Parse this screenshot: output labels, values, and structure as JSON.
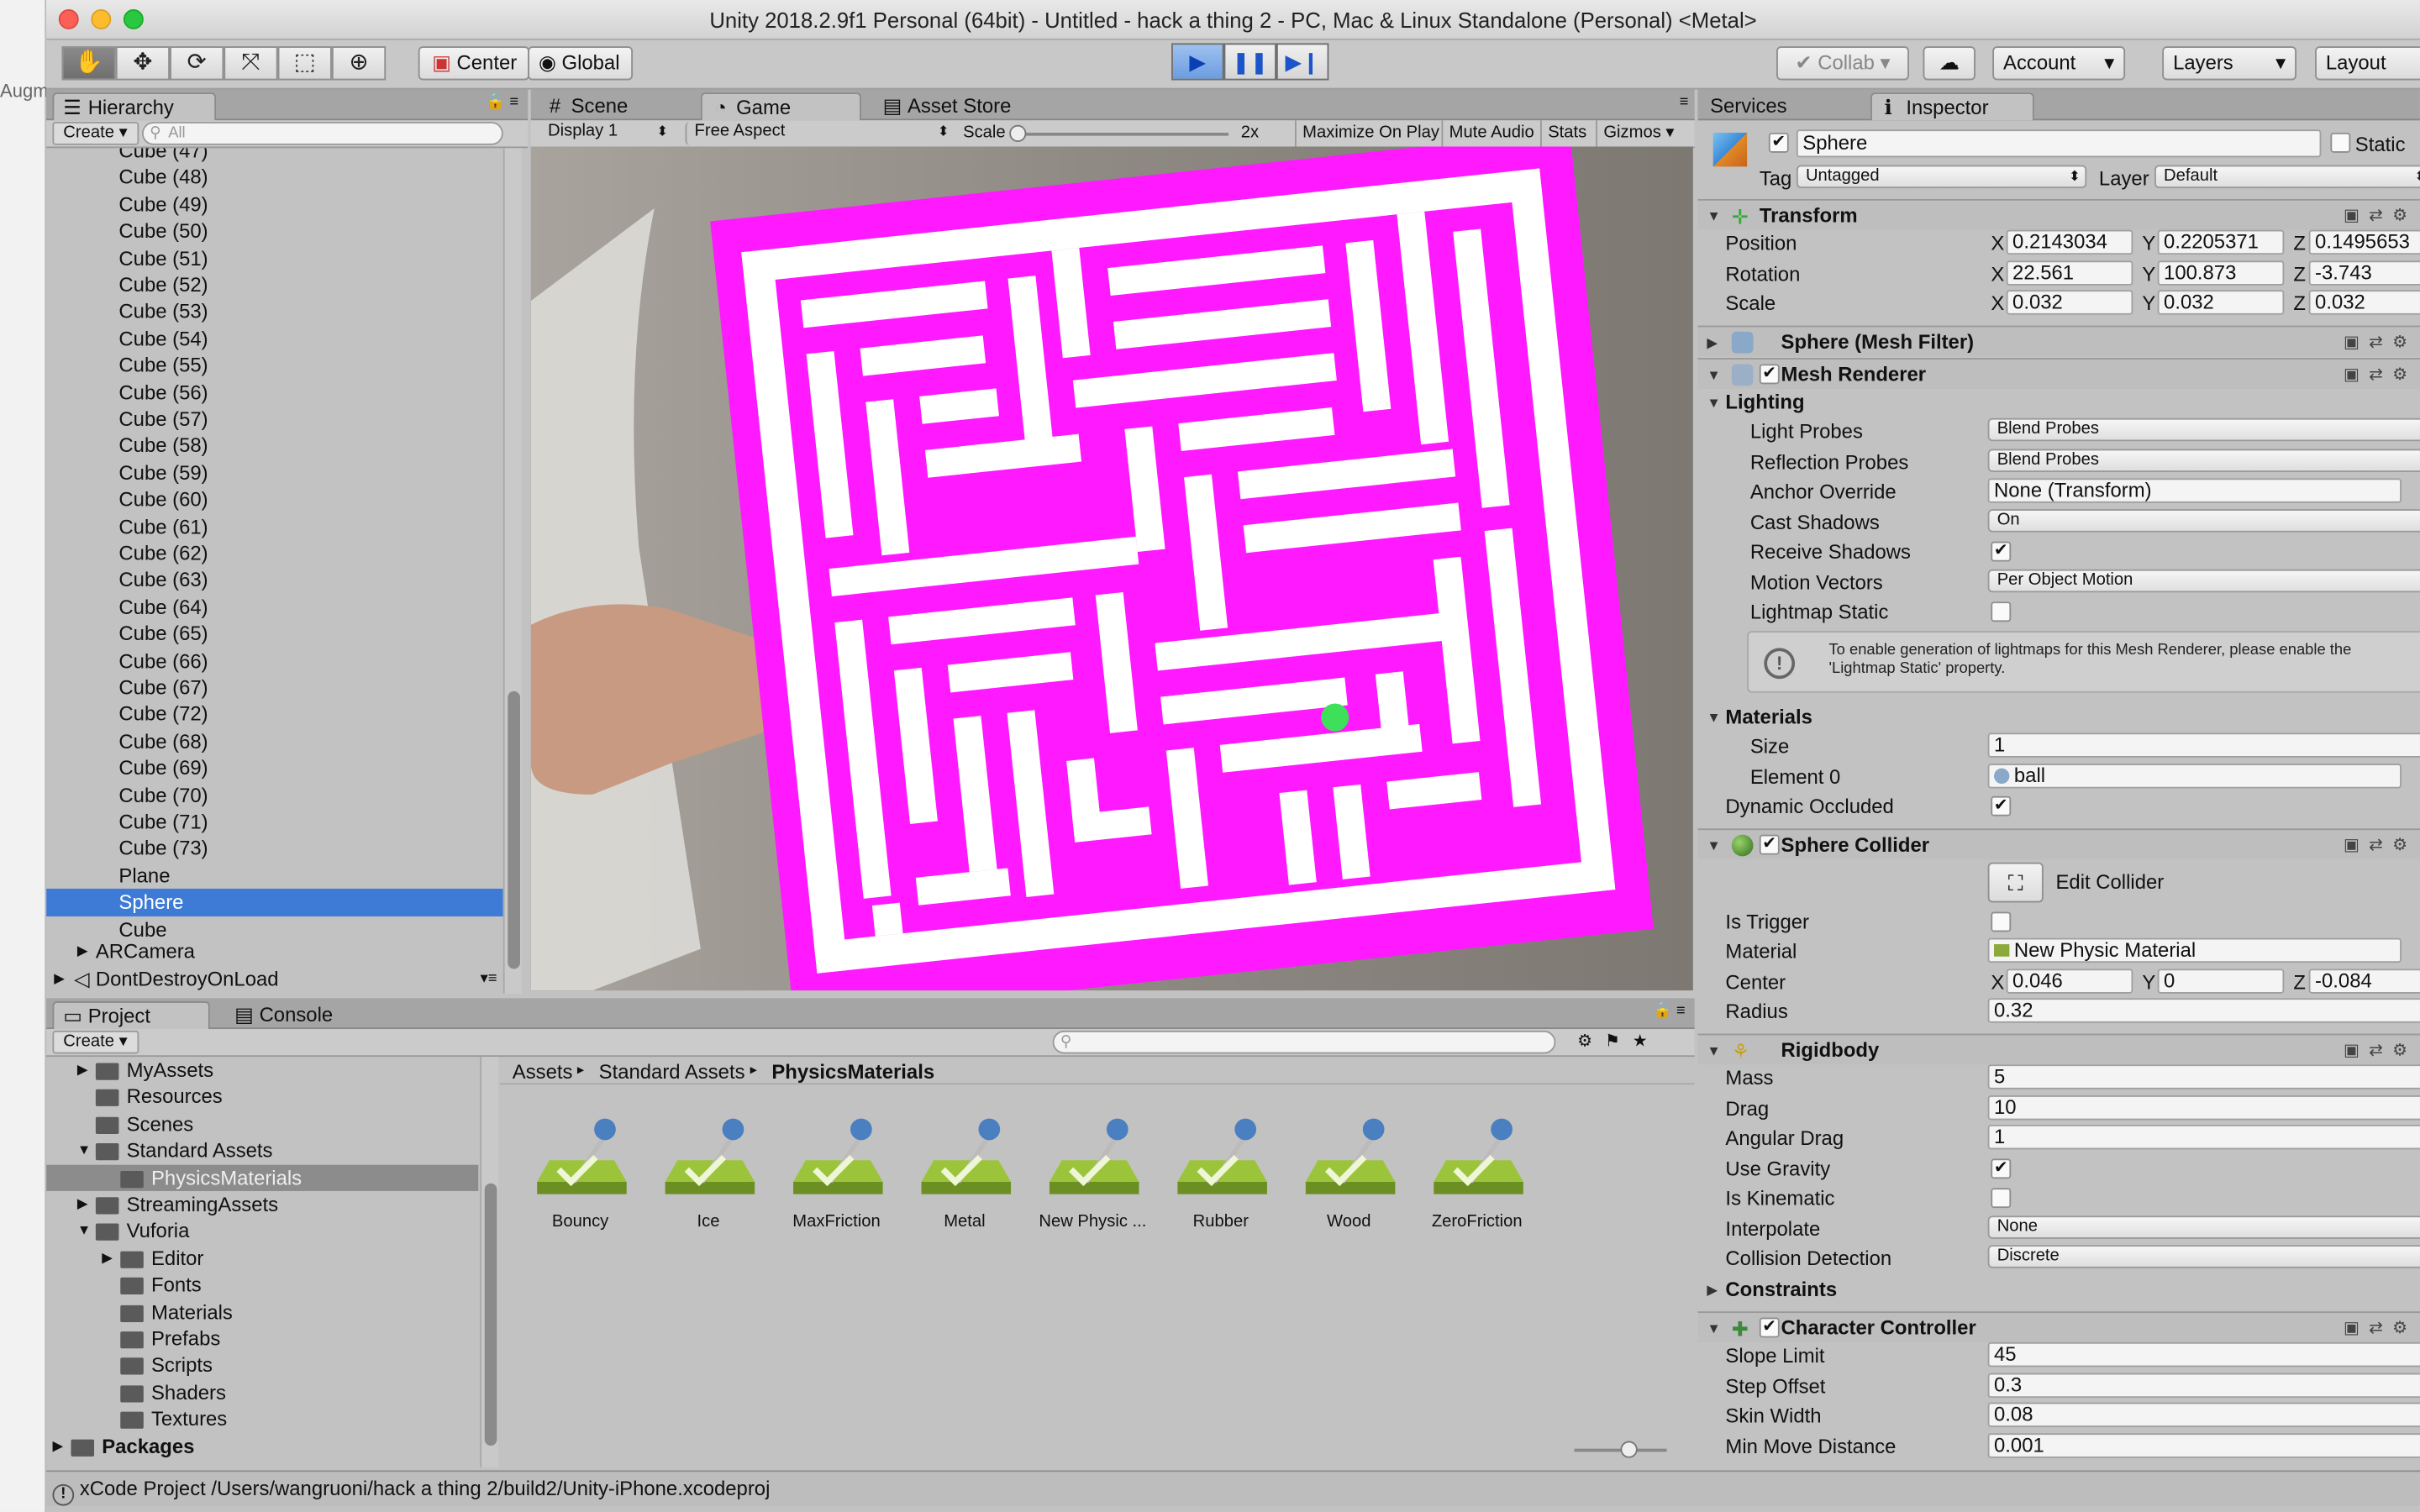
{
  "background_app": {
    "fragment": "Augm"
  },
  "window": {
    "title": "Unity 2018.2.9f1 Personal (64bit) - Untitled - hack a thing 2 - PC, Mac & Linux Standalone (Personal) <Metal>"
  },
  "toolbar": {
    "pivot_label": "Center",
    "space_label": "Global",
    "collab_label": "Collab",
    "account_label": "Account",
    "layers_label": "Layers",
    "layout_label": "Layout"
  },
  "hierarchy": {
    "tab_label": "Hierarchy",
    "create_label": "Create",
    "search_placeholder": "All",
    "partial_top": "Cube (47)",
    "items": [
      "Cube (48)",
      "Cube (49)",
      "Cube (50)",
      "Cube (51)",
      "Cube (52)",
      "Cube (53)",
      "Cube (54)",
      "Cube (55)",
      "Cube (56)",
      "Cube (57)",
      "Cube (58)",
      "Cube (59)",
      "Cube (60)",
      "Cube (61)",
      "Cube (62)",
      "Cube (63)",
      "Cube (64)",
      "Cube (65)",
      "Cube (66)",
      "Cube (67)",
      "Cube (72)",
      "Cube (68)",
      "Cube (69)",
      "Cube (70)",
      "Cube (71)",
      "Cube (73)",
      "Plane",
      "Sphere",
      "Cube"
    ],
    "selected": "Sphere",
    "arcamera_label": "ARCamera",
    "dontdestroy_label": "DontDestroyOnLoad"
  },
  "game": {
    "tabs": {
      "scene": "Scene",
      "game": "Game",
      "store": "Asset Store"
    },
    "display_label": "Display 1",
    "aspect_label": "Free Aspect",
    "scale_label": "Scale",
    "scale_value": "2x",
    "maximize_label": "Maximize On Play",
    "mute_label": "Mute Audio",
    "stats_label": "Stats",
    "gizmos_label": "Gizmos",
    "maze_color": "#ff19ff",
    "ball_color": "#3ee05a"
  },
  "project": {
    "tab_project": "Project",
    "tab_console": "Console",
    "create_label": "Create",
    "tree": [
      {
        "label": "MyAssets",
        "depth": 1,
        "arrow": "▶"
      },
      {
        "label": "Resources",
        "depth": 1,
        "arrow": ""
      },
      {
        "label": "Scenes",
        "depth": 1,
        "arrow": ""
      },
      {
        "label": "Standard Assets",
        "depth": 1,
        "arrow": "▼"
      },
      {
        "label": "PhysicsMaterials",
        "depth": 2,
        "arrow": "",
        "selected": true
      },
      {
        "label": "StreamingAssets",
        "depth": 1,
        "arrow": "▶"
      },
      {
        "label": "Vuforia",
        "depth": 1,
        "arrow": "▼"
      },
      {
        "label": "Editor",
        "depth": 2,
        "arrow": "▶"
      },
      {
        "label": "Fonts",
        "depth": 2,
        "arrow": ""
      },
      {
        "label": "Materials",
        "depth": 2,
        "arrow": ""
      },
      {
        "label": "Prefabs",
        "depth": 2,
        "arrow": ""
      },
      {
        "label": "Scripts",
        "depth": 2,
        "arrow": ""
      },
      {
        "label": "Shaders",
        "depth": 2,
        "arrow": ""
      },
      {
        "label": "Textures",
        "depth": 2,
        "arrow": ""
      },
      {
        "label": "Packages",
        "depth": 0,
        "arrow": "▶"
      }
    ],
    "breadcrumb": [
      "Assets",
      "Standard Assets",
      "PhysicsMaterials"
    ],
    "assets": [
      "Bouncy",
      "Ice",
      "MaxFriction",
      "Metal",
      "New Physic ...",
      "Rubber",
      "Wood",
      "ZeroFriction"
    ]
  },
  "inspector": {
    "tab_services": "Services",
    "tab_inspector": "Inspector",
    "object_name": "Sphere",
    "static_label": "Static",
    "tag_label": "Tag",
    "tag_value": "Untagged",
    "layer_label": "Layer",
    "layer_value": "Default",
    "transform": {
      "title": "Transform",
      "position_label": "Position",
      "position": {
        "x": "0.2143034",
        "y": "0.2205371",
        "z": "0.1495653"
      },
      "rotation_label": "Rotation",
      "rotation": {
        "x": "22.561",
        "y": "100.873",
        "z": "-3.743"
      },
      "scale_label": "Scale",
      "scale": {
        "x": "0.032",
        "y": "0.032",
        "z": "0.032"
      }
    },
    "mesh_filter_title": "Sphere (Mesh Filter)",
    "mesh_renderer": {
      "title": "Mesh Renderer",
      "lighting_label": "Lighting",
      "light_probes_label": "Light Probes",
      "light_probes": "Blend Probes",
      "reflection_probes_label": "Reflection Probes",
      "reflection_probes": "Blend Probes",
      "anchor_override_label": "Anchor Override",
      "anchor_override": "None (Transform)",
      "cast_shadows_label": "Cast Shadows",
      "cast_shadows": "On",
      "receive_shadows_label": "Receive Shadows",
      "motion_vectors_label": "Motion Vectors",
      "motion_vectors": "Per Object Motion",
      "lightmap_static_label": "Lightmap Static",
      "info_text": "To enable generation of lightmaps for this Mesh Renderer, please enable the 'Lightmap Static' property.",
      "materials_label": "Materials",
      "size_label": "Size",
      "size": "1",
      "element0_label": "Element 0",
      "element0": "ball",
      "dynamic_occluded_label": "Dynamic Occluded"
    },
    "sphere_collider": {
      "title": "Sphere Collider",
      "edit_collider_label": "Edit Collider",
      "is_trigger_label": "Is Trigger",
      "material_label": "Material",
      "material": "New Physic Material",
      "center_label": "Center",
      "center": {
        "x": "0.046",
        "y": "0",
        "z": "-0.084"
      },
      "radius_label": "Radius",
      "radius": "0.32"
    },
    "rigidbody": {
      "title": "Rigidbody",
      "mass_label": "Mass",
      "mass": "5",
      "drag_label": "Drag",
      "drag": "10",
      "angular_drag_label": "Angular Drag",
      "angular_drag": "1",
      "use_gravity_label": "Use Gravity",
      "is_kinematic_label": "Is Kinematic",
      "interpolate_label": "Interpolate",
      "interpolate": "None",
      "collision_detection_label": "Collision Detection",
      "collision_detection": "Discrete",
      "constraints_label": "Constraints"
    },
    "character_controller": {
      "title": "Character Controller",
      "slope_limit_label": "Slope Limit",
      "slope_limit": "45",
      "step_offset_label": "Step Offset",
      "step_offset": "0.3",
      "skin_width_label": "Skin Width",
      "skin_width": "0.08",
      "min_move_label": "Min Move Distance",
      "min_move": "0.001"
    }
  },
  "status": {
    "message": "xCode Project /Users/wangruoni/hack a thing 2/build2/Unity-iPhone.xcodeproj"
  }
}
